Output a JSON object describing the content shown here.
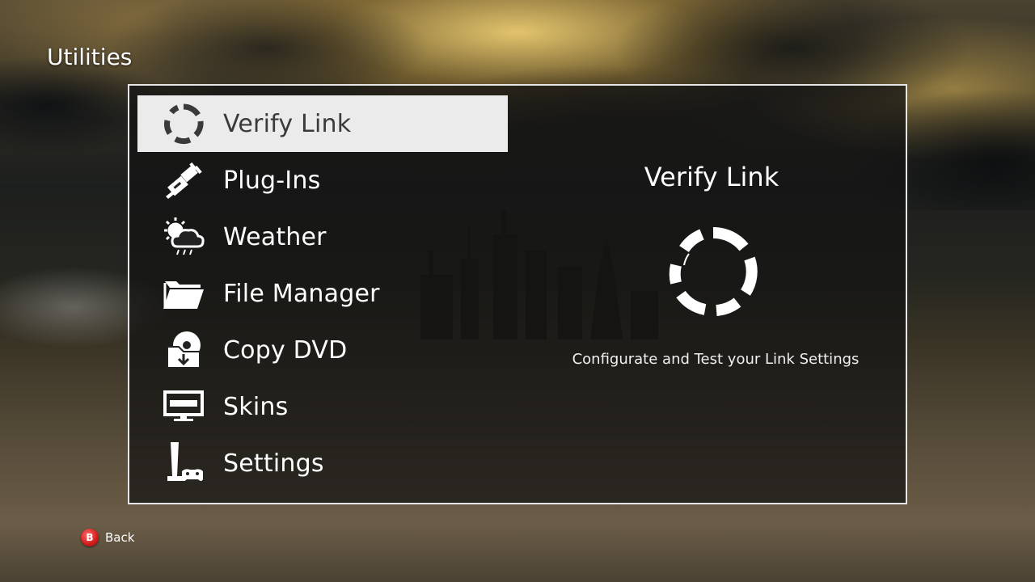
{
  "header": {
    "title": "Utilities"
  },
  "menu": {
    "items": [
      {
        "label": "Verify Link",
        "icon": "link-ring-icon",
        "selected": true
      },
      {
        "label": "Plug-Ins",
        "icon": "plug-icon",
        "selected": false
      },
      {
        "label": "Weather",
        "icon": "weather-icon",
        "selected": false
      },
      {
        "label": "File Manager",
        "icon": "folder-icon",
        "selected": false
      },
      {
        "label": "Copy DVD",
        "icon": "disc-copy-icon",
        "selected": false
      },
      {
        "label": "Skins",
        "icon": "screen-icon",
        "selected": false
      },
      {
        "label": "Settings",
        "icon": "console-controller-icon",
        "selected": false
      }
    ]
  },
  "detail": {
    "title": "Verify Link",
    "icon": "link-ring-icon",
    "description": "Configurate and Test your Link Settings"
  },
  "footer": {
    "back_button_glyph": "B",
    "back_label": "Back"
  },
  "colors": {
    "selected_bg": "#ebebeb",
    "selected_text": "#3a3a3a",
    "text": "#ffffff",
    "panel_border": "#e6e6e6",
    "b_button": "#d11b1b"
  }
}
